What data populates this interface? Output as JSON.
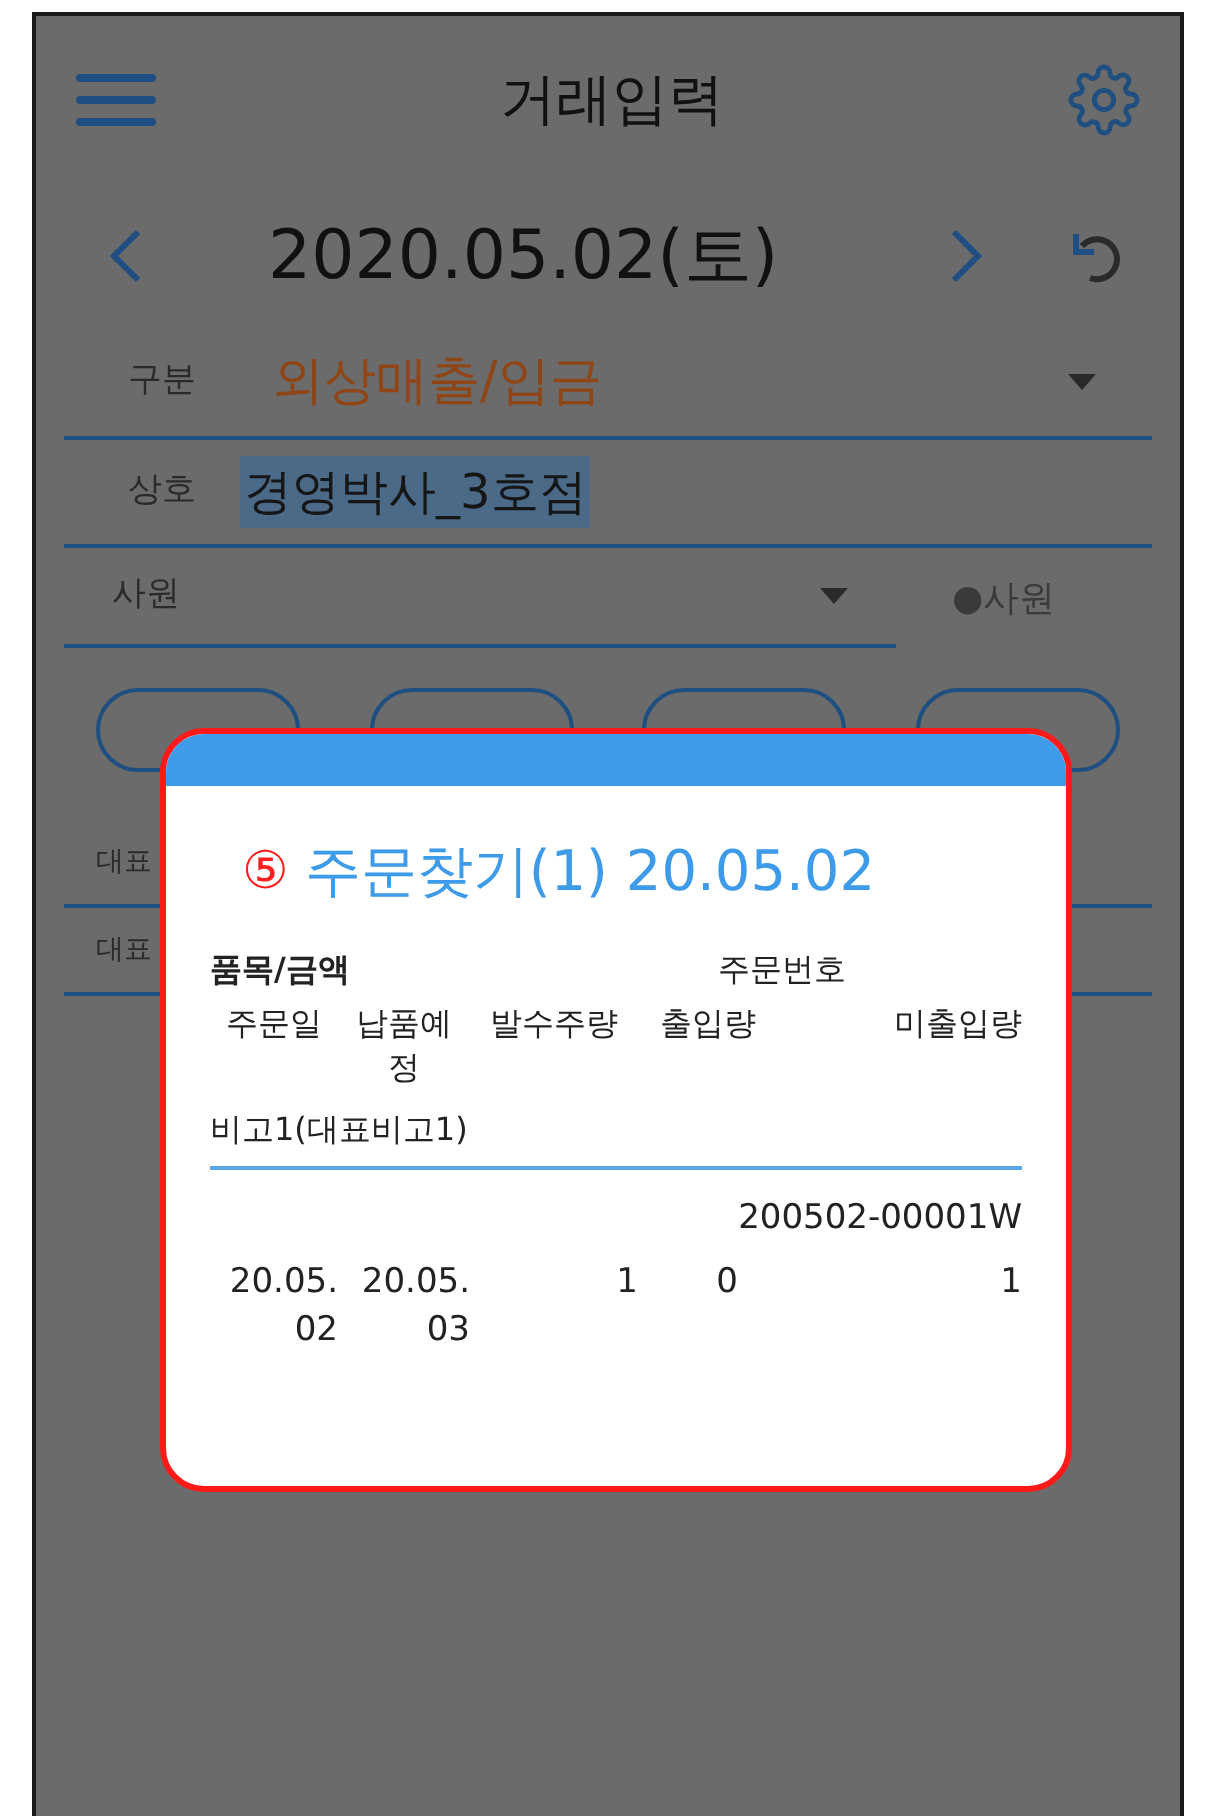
{
  "app_bar": {
    "title": "거래입력"
  },
  "date_bar": {
    "date": "2020.05.02(토)"
  },
  "fields": [
    {
      "kind": "select",
      "label": "구분",
      "value": "외상매출/입금"
    },
    {
      "kind": "text",
      "label": "상호",
      "value": "경영박사_3호점",
      "selected": true
    },
    {
      "kind": "employee",
      "label": "사원",
      "toggle": "●사원"
    }
  ],
  "rep_rows": [
    {
      "label": "대표"
    },
    {
      "label": "대표"
    }
  ],
  "dialog": {
    "badge": "⑤",
    "title": "주문찾기(1) 20.05.02",
    "header": {
      "item": "품목/금액",
      "order_no": "주문번호",
      "columns": [
        "주문일",
        "납품예정",
        "발수주량",
        "출입량",
        "미출입량"
      ],
      "note": "비고1(대표비고1)"
    },
    "rows": [
      {
        "order_no": "200502-00001W",
        "cells": [
          "20.05.02",
          "20.05.03",
          "1",
          "0",
          "1"
        ]
      }
    ]
  }
}
